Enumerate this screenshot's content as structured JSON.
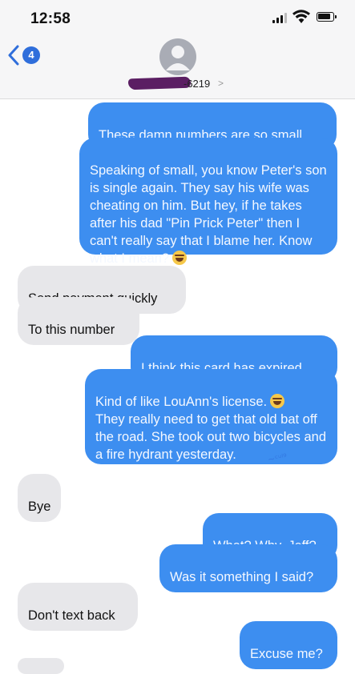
{
  "status_bar": {
    "time": "12:58"
  },
  "header": {
    "back_badge": "4",
    "contact_number_partial": "-6219",
    "contact_chevron": ">"
  },
  "messages": [
    {
      "side": "out",
      "text": "These damn numbers are so small."
    },
    {
      "side": "out",
      "text": "Speaking of small, you know Peter's son is single again. They say his wife was cheating on him. But hey, if he takes after his dad \"Pin Prick Peter\" then I can't really say that I blame her. Know what I mean?",
      "emoji": "laughing-tears"
    },
    {
      "side": "in",
      "text": "Send payment quickly"
    },
    {
      "side": "in",
      "text": "To this number"
    },
    {
      "side": "out",
      "text": "I think this card has expired."
    },
    {
      "side": "out",
      "text": "Kind of like LouAnn's license.",
      "emoji": "laughing-tears",
      "text2": "They really need to get that old bat off the road. She took out two bicycles and a fire hydrant yesterday."
    },
    {
      "side": "in",
      "text": "Bye"
    },
    {
      "side": "out",
      "text": "What? Why, Jeff?"
    },
    {
      "side": "out",
      "text": "Was it something I said?"
    },
    {
      "side": "in",
      "text": "Don't text back"
    },
    {
      "side": "out",
      "text": "Excuse me?"
    }
  ],
  "colors": {
    "outgoing": "#3d8ef0",
    "incoming": "#e7e7ea",
    "accent": "#2f6edb",
    "redaction": "#5b1e63"
  },
  "icons": [
    "signal-icon",
    "wifi-icon",
    "battery-icon",
    "back-chevron-icon",
    "contact-avatar-icon",
    "laughing-tears-emoji"
  ]
}
